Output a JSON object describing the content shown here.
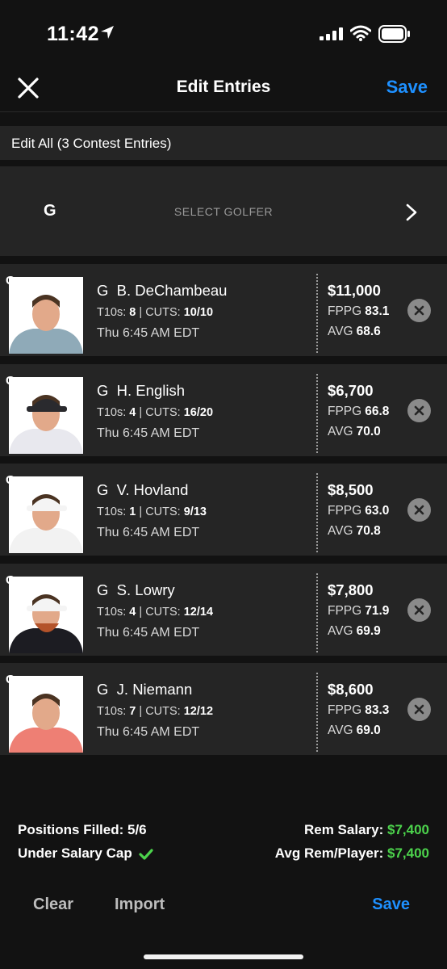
{
  "status_bar": {
    "time": "11:42"
  },
  "nav": {
    "title": "Edit Entries",
    "save_label": "Save"
  },
  "edit_all": {
    "label": "Edit All (3 Contest Entries)"
  },
  "select_golfer": {
    "position": "G",
    "label": "SELECT GOLFER"
  },
  "players": [
    {
      "pos_tag": "G",
      "pos": "G",
      "name": "B. DeChambeau",
      "t10s_label": "T10s:",
      "t10s": "8",
      "cuts_label": "CUTS:",
      "cuts": "10/10",
      "time": "Thu 6:45 AM EDT",
      "salary": "$11,000",
      "fppg_label": "FPPG",
      "fppg": "83.1",
      "avg_label": "AVG",
      "avg": "68.6",
      "shirt_color": "#8faab8",
      "hat": "none"
    },
    {
      "pos_tag": "G",
      "pos": "G",
      "name": "H. English",
      "t10s_label": "T10s:",
      "t10s": "4",
      "cuts_label": "CUTS:",
      "cuts": "16/20",
      "time": "Thu 6:45 AM EDT",
      "salary": "$6,700",
      "fppg_label": "FPPG",
      "fppg": "66.8",
      "avg_label": "AVG",
      "avg": "70.0",
      "shirt_color": "#e8e8ee",
      "hat": "dark"
    },
    {
      "pos_tag": "G",
      "pos": "G",
      "name": "V. Hovland",
      "t10s_label": "T10s:",
      "t10s": "1",
      "cuts_label": "CUTS:",
      "cuts": "9/13",
      "time": "Thu 6:45 AM EDT",
      "salary": "$8,500",
      "fppg_label": "FPPG",
      "fppg": "63.0",
      "avg_label": "AVG",
      "avg": "70.8",
      "shirt_color": "#f2f2f2",
      "hat": "light"
    },
    {
      "pos_tag": "G",
      "pos": "G",
      "name": "S. Lowry",
      "t10s_label": "T10s:",
      "t10s": "4",
      "cuts_label": "CUTS:",
      "cuts": "12/14",
      "time": "Thu 6:45 AM EDT",
      "salary": "$7,800",
      "fppg_label": "FPPG",
      "fppg": "71.9",
      "avg_label": "AVG",
      "avg": "69.9",
      "shirt_color": "#1c1c22",
      "hat": "light"
    },
    {
      "pos_tag": "G",
      "pos": "G",
      "name": "J. Niemann",
      "t10s_label": "T10s:",
      "t10s": "7",
      "cuts_label": "CUTS:",
      "cuts": "12/12",
      "time": "Thu 6:45 AM EDT",
      "salary": "$8,600",
      "fppg_label": "FPPG",
      "fppg": "83.3",
      "avg_label": "AVG",
      "avg": "69.0",
      "shirt_color": "#ee7f74",
      "hat": "none"
    }
  ],
  "footer": {
    "positions_filled": "Positions Filled: 5/6",
    "under_cap": "Under Salary Cap",
    "rem_salary_label": "Rem Salary:",
    "rem_salary_value": "$7,400",
    "avg_rem_label": "Avg Rem/Player:",
    "avg_rem_value": "$7,400"
  },
  "bottom": {
    "clear_label": "Clear",
    "import_label": "Import",
    "save_label": "Save"
  },
  "colors": {
    "accent": "#1e90ff",
    "positive": "#4cd34c",
    "background": "#121212",
    "row": "#252525"
  },
  "icons": [
    "location-arrow-icon",
    "signal-icon",
    "wifi-icon",
    "battery-icon",
    "close-icon",
    "chevron-right-icon",
    "remove-icon",
    "checkmark-icon"
  ]
}
